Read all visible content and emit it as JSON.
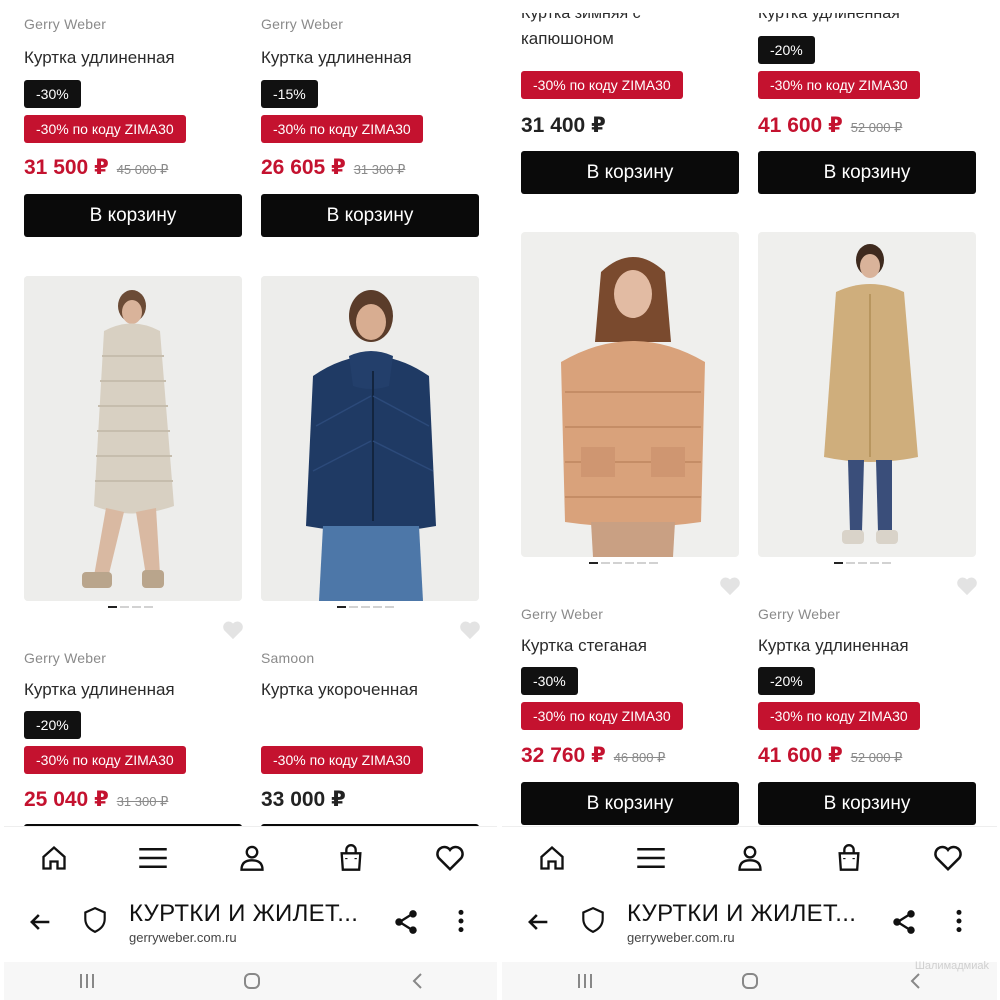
{
  "cart_label": "В корзину",
  "colors": {
    "accent": "#c4122f",
    "button": "#0a0a0a",
    "badge": "#111111"
  },
  "left": {
    "top_cards": [
      {
        "brand": "Gerry Weber",
        "title": "Куртка удлиненная",
        "badge": "-30%",
        "promo": "-30% по коду ZIMA30",
        "price": "31 500 ₽",
        "old": "45 000 ₽"
      },
      {
        "brand": "Gerry Weber",
        "title": "Куртка удлиненная",
        "badge": "-15%",
        "promo": "-30% по коду ZIMA30",
        "price": "26 605 ₽",
        "old": "31 300 ₽"
      }
    ],
    "bottom_cards": [
      {
        "brand": "Gerry Weber",
        "title": "Куртка удлиненная",
        "badge": "-20%",
        "promo": "-30% по коду ZIMA30",
        "price": "25 040 ₽",
        "old": "31 300 ₽"
      },
      {
        "brand": "Samoon",
        "title": "Куртка укороченная",
        "promo": "-30% по коду ZIMA30",
        "price": "33 000 ₽"
      }
    ]
  },
  "right": {
    "top_cards": [
      {
        "title_partial": "Куртка зимняя с",
        "title_line2": "капюшоном",
        "promo": "-30% по коду ZIMA30",
        "price": "31 400 ₽"
      },
      {
        "title_partial": "Куртка удлиненная",
        "badge": "-20%",
        "promo": "-30% по коду ZIMA30",
        "price": "41 600 ₽",
        "old": "52 000 ₽"
      }
    ],
    "bottom_cards": [
      {
        "brand": "Gerry Weber",
        "title": "Куртка стеганая",
        "badge": "-30%",
        "promo": "-30% по коду ZIMA30",
        "price": "32 760 ₽",
        "old": "46 800 ₽"
      },
      {
        "brand": "Gerry Weber",
        "title": "Куртка удлиненная",
        "badge": "-20%",
        "promo": "-30% по коду ZIMA30",
        "price": "41 600 ₽",
        "old": "52 000 ₽"
      }
    ]
  },
  "browser": {
    "page_title": "КУРТКИ И ЖИЛЕТ...",
    "domain": "gerryweber.com.ru"
  },
  "nav_icons": [
    "home-icon",
    "menu-icon",
    "profile-icon",
    "cart-bag-icon",
    "wishlist-heart-icon"
  ],
  "watermark": "Шалимадмиаk"
}
